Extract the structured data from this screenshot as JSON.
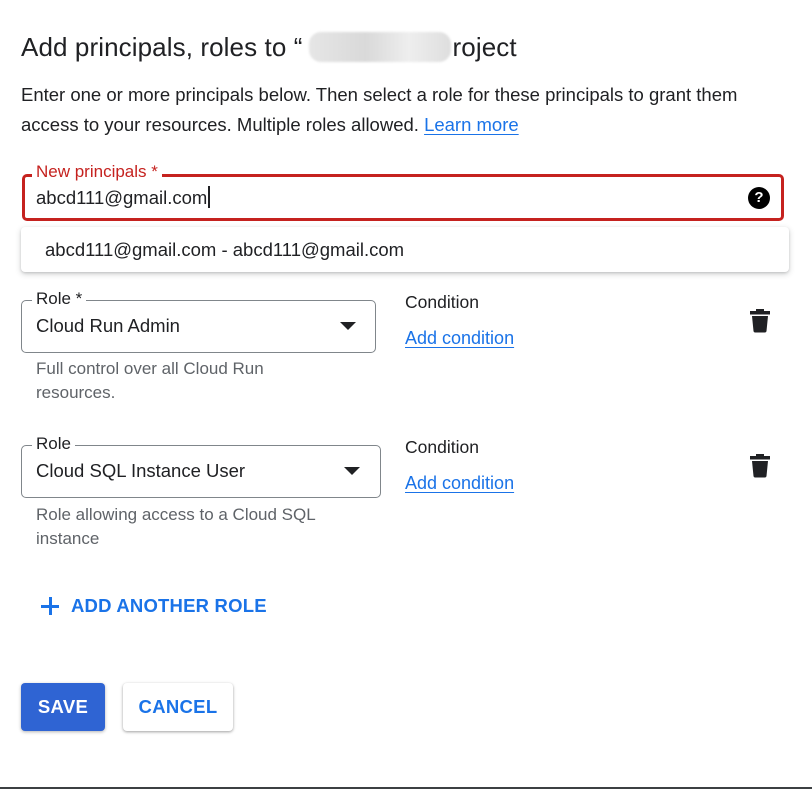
{
  "dialog": {
    "title_prefix": "Add principals, roles to “",
    "title_suffix": "roject",
    "intro": "Enter one or more principals below. Then select a role for these principals to grant them access to your resources. Multiple roles allowed. ",
    "learn_more": "Learn more"
  },
  "principals": {
    "label": "New principals *",
    "value": "abcd111@gmail.com",
    "suggestion": "abcd111@gmail.com - abcd111@gmail.com"
  },
  "roles": [
    {
      "label": "Role *",
      "value": "Cloud Run Admin",
      "description": "Full control over all Cloud Run resources.",
      "condition_title": "Condition",
      "condition_link": "Add condition"
    },
    {
      "label": "Role",
      "value": "Cloud SQL Instance User",
      "description": "Role allowing access to a Cloud SQL instance",
      "condition_title": "Condition",
      "condition_link": "Add condition"
    }
  ],
  "actions": {
    "add_role": "ADD ANOTHER ROLE",
    "save": "SAVE",
    "cancel": "CANCEL"
  },
  "colors": {
    "accent": "#1a73e8",
    "error": "#c5221f",
    "save_button": "#2f64d3"
  },
  "icons": {
    "help": "help-circle-icon",
    "delete": "trash-icon",
    "dropdown": "dropdown-arrow-icon",
    "add": "plus-icon"
  }
}
